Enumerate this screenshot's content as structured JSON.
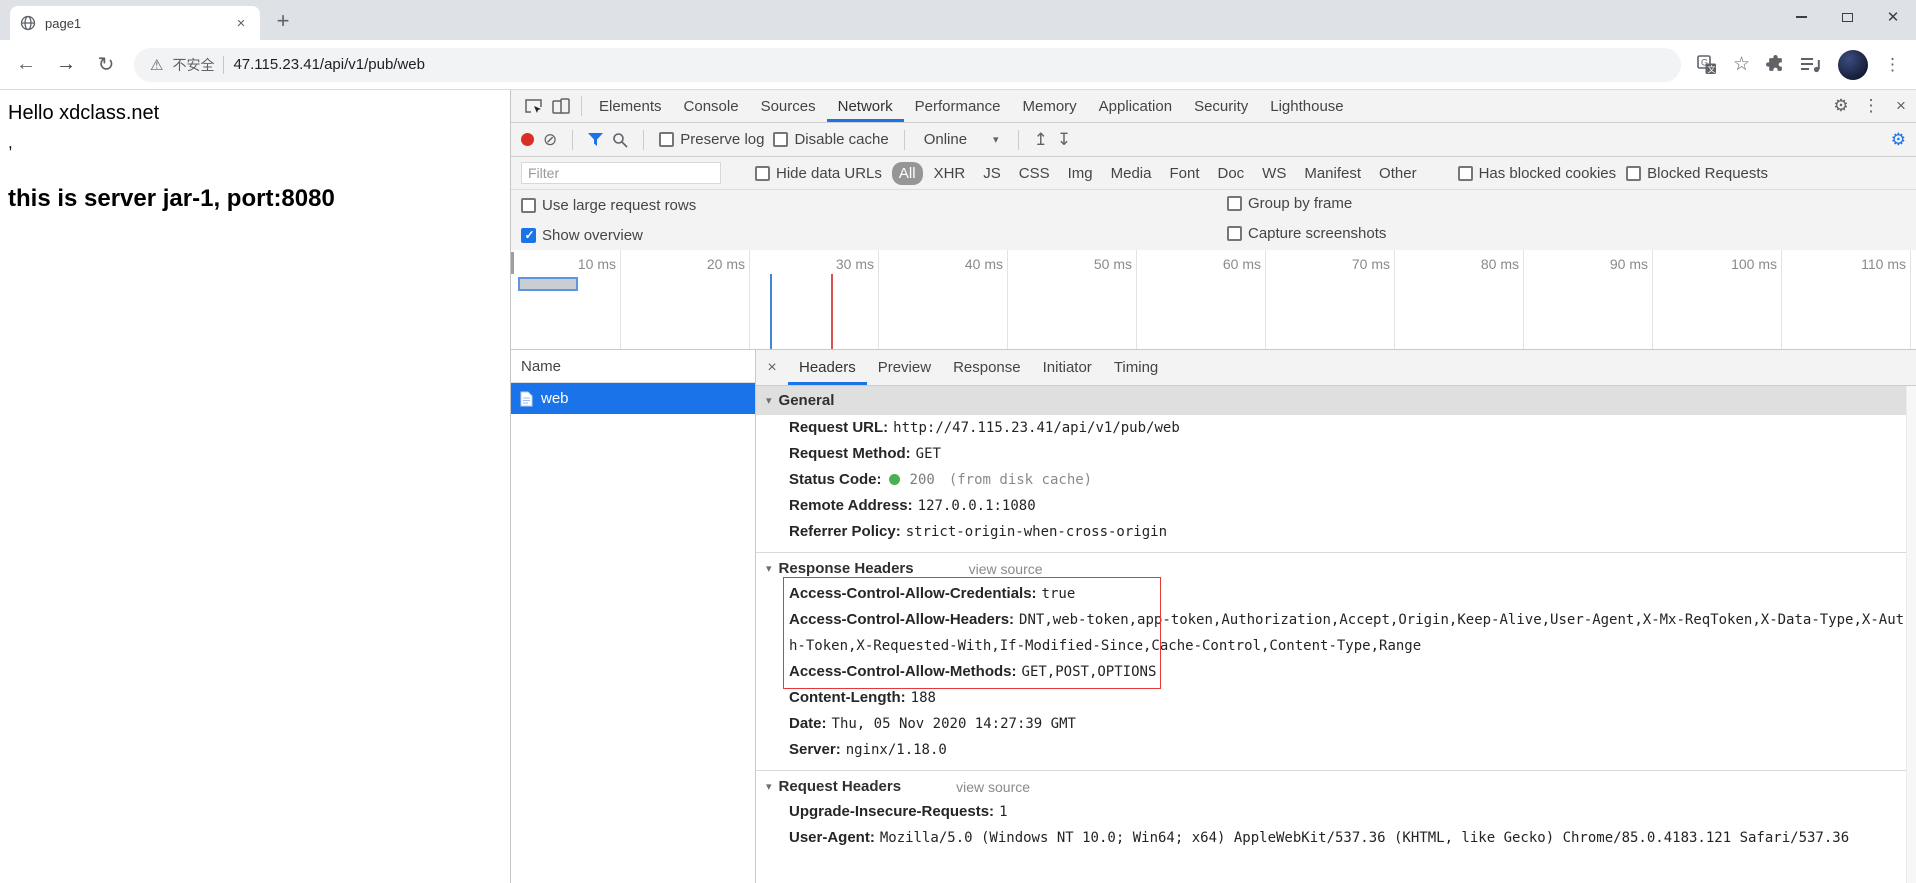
{
  "colors": {
    "accent": "#1a73e8",
    "record_red": "#d93025",
    "selected_row": "#1a73e8",
    "status_green": "#4caf50",
    "annotation_red": "#e53935"
  },
  "icons": {
    "close": "×",
    "plus": "+",
    "back": "←",
    "forward": "→",
    "reload": "↻",
    "warning": "⚠",
    "star": "☆",
    "more_vertical": "⋮",
    "gear": "⚙",
    "clear": "⊘",
    "dropdown": "▾",
    "upload": "↥",
    "download": "↧",
    "section_arrow": "▾",
    "window_close": "✕"
  },
  "browser": {
    "tab": {
      "title": "page1"
    },
    "address": {
      "security": "不安全",
      "url": "47.115.23.41/api/v1/pub/web"
    }
  },
  "page": {
    "line1": "Hello xdclass.net",
    "comma": ",",
    "line3": "this is server jar-1, port:8080"
  },
  "devtools": {
    "tabs": [
      {
        "label": "Elements"
      },
      {
        "label": "Console"
      },
      {
        "label": "Sources"
      },
      {
        "label": "Network",
        "active": true
      },
      {
        "label": "Performance"
      },
      {
        "label": "Memory"
      },
      {
        "label": "Application"
      },
      {
        "label": "Security"
      },
      {
        "label": "Lighthouse"
      }
    ],
    "netbar": {
      "preserve_log": {
        "label": "Preserve log",
        "checked": false
      },
      "disable_cache": {
        "label": "Disable cache",
        "checked": false
      },
      "throttling": "Online"
    },
    "filterbar": {
      "placeholder": "Filter",
      "hide_data_urls": {
        "label": "Hide data URLs",
        "checked": false
      },
      "types": [
        {
          "label": "All",
          "active": true
        },
        {
          "label": "XHR"
        },
        {
          "label": "JS"
        },
        {
          "label": "CSS"
        },
        {
          "label": "Img"
        },
        {
          "label": "Media"
        },
        {
          "label": "Font"
        },
        {
          "label": "Doc"
        },
        {
          "label": "WS"
        },
        {
          "label": "Manifest"
        },
        {
          "label": "Other"
        }
      ],
      "has_blocked_cookies": {
        "label": "Has blocked cookies",
        "checked": false
      },
      "blocked_requests": {
        "label": "Blocked Requests",
        "checked": false
      }
    },
    "options": {
      "use_large_rows": {
        "label": "Use large request rows",
        "checked": false
      },
      "group_by_frame": {
        "label": "Group by frame",
        "checked": false
      },
      "show_overview": {
        "label": "Show overview",
        "checked": true
      },
      "capture_screenshots": {
        "label": "Capture screenshots",
        "checked": false
      }
    },
    "timeline": {
      "ticks": [
        "10 ms",
        "20 ms",
        "30 ms",
        "40 ms",
        "50 ms",
        "60 ms",
        "70 ms",
        "80 ms",
        "90 ms",
        "100 ms",
        "110 ms"
      ]
    },
    "requests": {
      "name_header": "Name",
      "rows": [
        {
          "name": "web",
          "selected": true
        }
      ]
    },
    "details": {
      "tabs": [
        {
          "label": "Headers",
          "active": true
        },
        {
          "label": "Preview"
        },
        {
          "label": "Response"
        },
        {
          "label": "Initiator"
        },
        {
          "label": "Timing"
        }
      ],
      "general": {
        "title": "General",
        "rows": [
          {
            "name": "Request URL:",
            "value": "http://47.115.23.41/api/v1/pub/web"
          },
          {
            "name": "Request Method:",
            "value": "GET"
          },
          {
            "name": "Status Code:",
            "dot": "#4caf50",
            "value": "200",
            "suffix": "(from disk cache)"
          },
          {
            "name": "Remote Address:",
            "value": "127.0.0.1:1080"
          },
          {
            "name": "Referrer Policy:",
            "value": "strict-origin-when-cross-origin"
          }
        ]
      },
      "response_headers": {
        "title": "Response Headers",
        "view_source": "view source",
        "highlighted_rows": [
          {
            "name": "Access-Control-Allow-Credentials:",
            "value": "true"
          },
          {
            "name": "Access-Control-Allow-Headers:",
            "value": "DNT,web-token,app-token,Authorization,Accept,Origin,Keep-Alive,User-Agent,X-Mx-ReqToken,X-Data-Type,X-Auth-Token,X-Requested-With,If-Modified-Since,Cache-Control,Content-Type,Range"
          },
          {
            "name": "Access-Control-Allow-Methods:",
            "value": "GET,POST,OPTIONS"
          }
        ],
        "rows": [
          {
            "name": "Content-Length:",
            "value": "188"
          },
          {
            "name": "Date:",
            "value": "Thu, 05 Nov 2020 14:27:39 GMT"
          },
          {
            "name": "Server:",
            "value": "nginx/1.18.0"
          }
        ]
      },
      "request_headers": {
        "title": "Request Headers",
        "view_source": "view source",
        "rows": [
          {
            "name": "Upgrade-Insecure-Requests:",
            "value": "1"
          },
          {
            "name": "User-Agent:",
            "value": "Mozilla/5.0 (Windows NT 10.0; Win64; x64) AppleWebKit/537.36 (KHTML, like Gecko) Chrome/85.0.4183.121 Safari/537.36"
          }
        ]
      }
    }
  }
}
